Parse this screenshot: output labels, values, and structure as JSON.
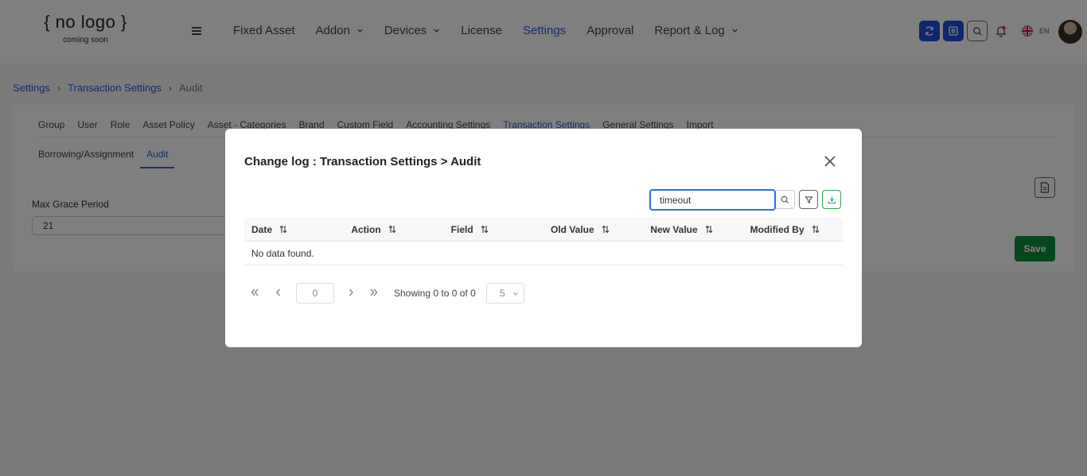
{
  "header": {
    "logo_main": "{ no logo }",
    "logo_sub": "coming soon",
    "nav": [
      {
        "label": "Fixed Asset",
        "active": false,
        "dropdown": false
      },
      {
        "label": "Addon",
        "active": false,
        "dropdown": true
      },
      {
        "label": "Devices",
        "active": false,
        "dropdown": true
      },
      {
        "label": "License",
        "active": false,
        "dropdown": false
      },
      {
        "label": "Settings",
        "active": true,
        "dropdown": false
      },
      {
        "label": "Approval",
        "active": false,
        "dropdown": false
      },
      {
        "label": "Report & Log",
        "active": false,
        "dropdown": true
      }
    ],
    "actions": [
      "refresh-icon",
      "list-icon",
      "search-icon",
      "bell-icon"
    ],
    "language": "EN"
  },
  "breadcrumb": {
    "items": [
      "Settings",
      "Transaction Settings"
    ],
    "current": "Audit"
  },
  "settings": {
    "tabs": [
      "Group",
      "User",
      "Role",
      "Asset Policy",
      "Asset - Categories",
      "Brand",
      "Custom Field",
      "Accounting Settings",
      "Transaction Settings",
      "General Settings",
      "Import"
    ],
    "active_tab": "Transaction Settings",
    "subtabs": [
      "Borrowing/Assignment",
      "Audit"
    ],
    "active_subtab": "Audit",
    "field_label": "Max Grace Period",
    "field_value": "21",
    "save_label": "Save"
  },
  "modal": {
    "title": "Change log : Transaction Settings > Audit",
    "search_value": "timeout",
    "columns": [
      "Date",
      "Action",
      "Field",
      "Old Value",
      "New Value",
      "Modified By"
    ],
    "empty_text": "No data found.",
    "page_input": "0",
    "showing_text": "Showing 0 to 0 of 0",
    "page_size": "5"
  },
  "colors": {
    "accent": "#2f5bd8",
    "save": "#0e8a3a",
    "overlay": "rgba(0,0,0,0.5)"
  }
}
